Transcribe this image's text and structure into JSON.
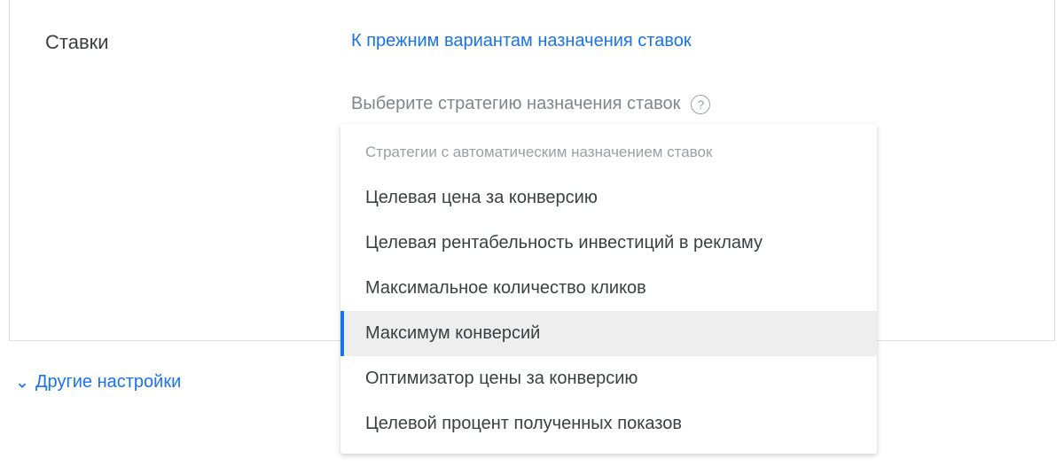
{
  "section": {
    "label": "Ставки"
  },
  "content": {
    "back_link": "К прежним вариантам назначения ставок",
    "subheading": "Выберите стратегию назначения ставок"
  },
  "dropdown": {
    "group_label": "Стратегии с автоматическим назначением ставок",
    "options": [
      {
        "label": "Целевая цена за конверсию",
        "selected": false
      },
      {
        "label": "Целевая рентабельность инвестиций в рекламу",
        "selected": false
      },
      {
        "label": "Максимальное количество кликов",
        "selected": false
      },
      {
        "label": "Максимум конверсий",
        "selected": true
      },
      {
        "label": "Оптимизатор цены за конверсию",
        "selected": false
      },
      {
        "label": "Целевой процент полученных показов",
        "selected": false
      }
    ]
  },
  "footer": {
    "other_settings": "Другие настройки"
  }
}
